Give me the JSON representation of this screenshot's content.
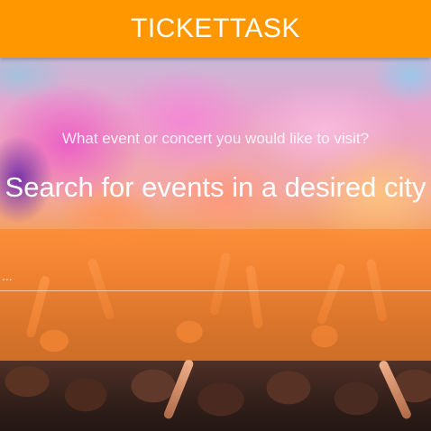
{
  "header": {
    "brand": "TICKETTASK",
    "background_color": "#ff9800"
  },
  "hero": {
    "tagline": "What event or concert you would like to visit?",
    "headline": "Search for events in a desired city"
  },
  "search": {
    "placeholder": "...",
    "panel_color": "#ff8728"
  }
}
